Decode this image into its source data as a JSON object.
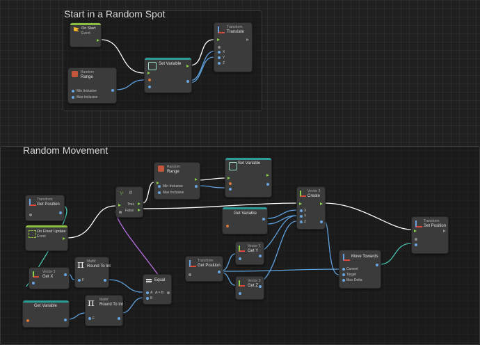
{
  "groups": {
    "start": {
      "title": "Start in a Random Spot"
    },
    "movement": {
      "title": "Random Movement"
    }
  },
  "nodes": {
    "on_start": {
      "category": "On Start",
      "title": "Event"
    },
    "random_range_1": {
      "category": "Random",
      "title": "Range",
      "ports": [
        "Min Inclusive",
        "Max Inclusive"
      ]
    },
    "set_variable_1": {
      "title": "Set Variable"
    },
    "translate": {
      "category": "Transform",
      "title": "Translate",
      "ports": [
        "X",
        "Y",
        "Z"
      ]
    },
    "get_position_1": {
      "category": "Transform",
      "title": "Get Position"
    },
    "on_fixed_update": {
      "category": "On Fixed Update",
      "title": "Event"
    },
    "if_node": {
      "title": "If",
      "ports": [
        "True",
        "False"
      ]
    },
    "random_range_2": {
      "category": "Random",
      "title": "Range",
      "ports": [
        "Min Inclusive",
        "Max Inclusive"
      ]
    },
    "set_variable_2": {
      "title": "Set Variable"
    },
    "get_variable_1": {
      "title": "Get Variable"
    },
    "vector3_create": {
      "category": "Vector 3",
      "title": "Create",
      "ports": [
        "X",
        "Y",
        "Z"
      ]
    },
    "set_position": {
      "category": "Transform",
      "title": "Set Position"
    },
    "get_x": {
      "category": "Vector 3",
      "title": "Get X"
    },
    "round_to_int_1": {
      "category": "Mathf",
      "title": "Round To Int",
      "ports": [
        "F"
      ]
    },
    "get_variable_2": {
      "title": "Get Variable"
    },
    "round_to_int_2": {
      "category": "Mathf",
      "title": "Round To Int",
      "ports": [
        "F"
      ]
    },
    "equal": {
      "title": "Equal",
      "ports": [
        "A",
        "A = B",
        "B"
      ]
    },
    "get_position_2": {
      "category": "Transform",
      "title": "Get Position"
    },
    "get_y": {
      "category": "Vector 3",
      "title": "Get Y"
    },
    "get_z": {
      "category": "Vector 3",
      "title": "Get Z"
    },
    "move_towards": {
      "title": "Move Towards",
      "ports": [
        "Current",
        "Target",
        "Max Delta"
      ]
    }
  },
  "colors": {
    "background": "#202020",
    "flow_wire": "#ffffff",
    "data_wire_blue": "#5fa3e0",
    "data_wire_teal": "#4bc7b4",
    "bool_wire": "#b56ee0",
    "flow_port": "#8ad24a",
    "event_strip": "#8bbe3f",
    "variable_strip": "#2a9c96"
  }
}
